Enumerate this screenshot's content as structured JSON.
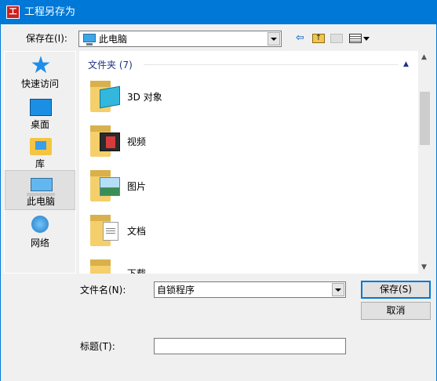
{
  "window": {
    "title": "工程另存为",
    "app_icon_glyph": "工"
  },
  "toolbar": {
    "save_in_label": "保存在(I):",
    "location": "此电脑",
    "icons": [
      "back-arrow-icon",
      "up-folder-icon",
      "new-folder-icon",
      "view-menu-icon"
    ]
  },
  "places": [
    {
      "label": "快速访问",
      "icon": "quick-access-star-icon"
    },
    {
      "label": "桌面",
      "icon": "desktop-icon"
    },
    {
      "label": "库",
      "icon": "library-icon"
    },
    {
      "label": "此电脑",
      "icon": "this-pc-icon",
      "selected": true
    },
    {
      "label": "网络",
      "icon": "network-icon"
    }
  ],
  "file_list": {
    "group_header": "文件夹 (7)",
    "items": [
      {
        "name": "3D 对象",
        "icon": "3d-objects-folder-icon"
      },
      {
        "name": "视频",
        "icon": "videos-folder-icon"
      },
      {
        "name": "图片",
        "icon": "pictures-folder-icon"
      },
      {
        "name": "文档",
        "icon": "documents-folder-icon"
      },
      {
        "name": "下载",
        "icon": "downloads-folder-icon"
      }
    ]
  },
  "form": {
    "filename_label": "文件名(N):",
    "filename_value": "自锁程序",
    "title_label": "标题(T):",
    "title_value": ""
  },
  "buttons": {
    "save": "保存(S)",
    "cancel": "取消"
  },
  "colors": {
    "titlebar": "#0078d7",
    "accent_text": "#1e3287",
    "window_bg": "#f0f0f0"
  }
}
